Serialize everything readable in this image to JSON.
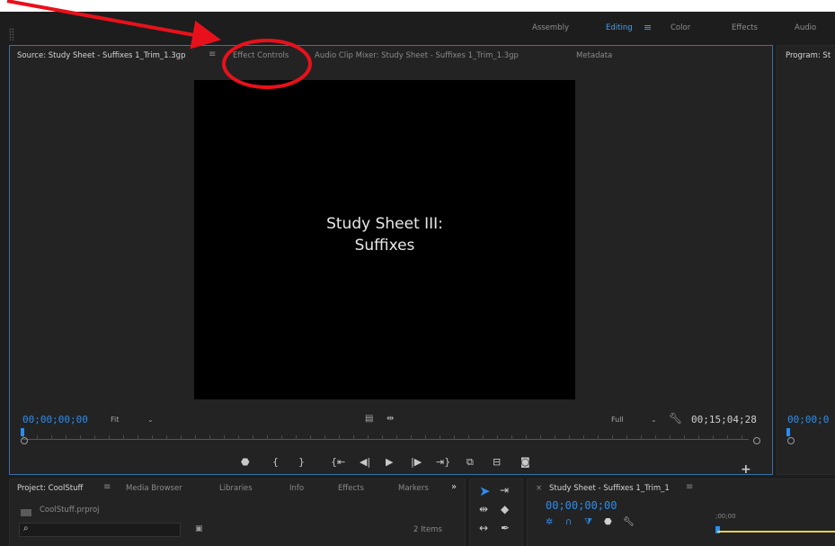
{
  "workspaces": [
    "Assembly",
    "Editing",
    "Color",
    "Effects",
    "Audio"
  ],
  "active_workspace": "Editing",
  "source_panel": {
    "tabs": [
      "Source: Study Sheet - Suffixes 1_Trim_1.3gp",
      "Effect Controls",
      "Audio Clip Mixer: Study Sheet - Suffixes 1_Trim_1.3gp",
      "Metadata"
    ],
    "video_title_line1": "Study Sheet III:",
    "video_title_line2": "Suffixes",
    "timecode_in": "00;00;00;00",
    "zoom": "Fit",
    "resolution": "Full",
    "duration": "00;15;04;28"
  },
  "program_panel": {
    "tab": "Program: St",
    "timecode": "00;00;0"
  },
  "project_panel": {
    "tabs": [
      "Project: CoolStuff",
      "Media Browser",
      "Libraries",
      "Info",
      "Effects",
      "Markers"
    ],
    "file": "CoolStuff.prproj",
    "items_count": "2 Items"
  },
  "timeline_panel": {
    "tab": "Study Sheet - Suffixes 1_Trim_1",
    "timecode": "00;00;00;00",
    "ruler_label": ";00;00"
  },
  "icons": {
    "menu": "≡",
    "close": "×",
    "chevrons": "»"
  },
  "colors": {
    "accent": "#2d8ceb",
    "annotation": "#e8111b"
  }
}
